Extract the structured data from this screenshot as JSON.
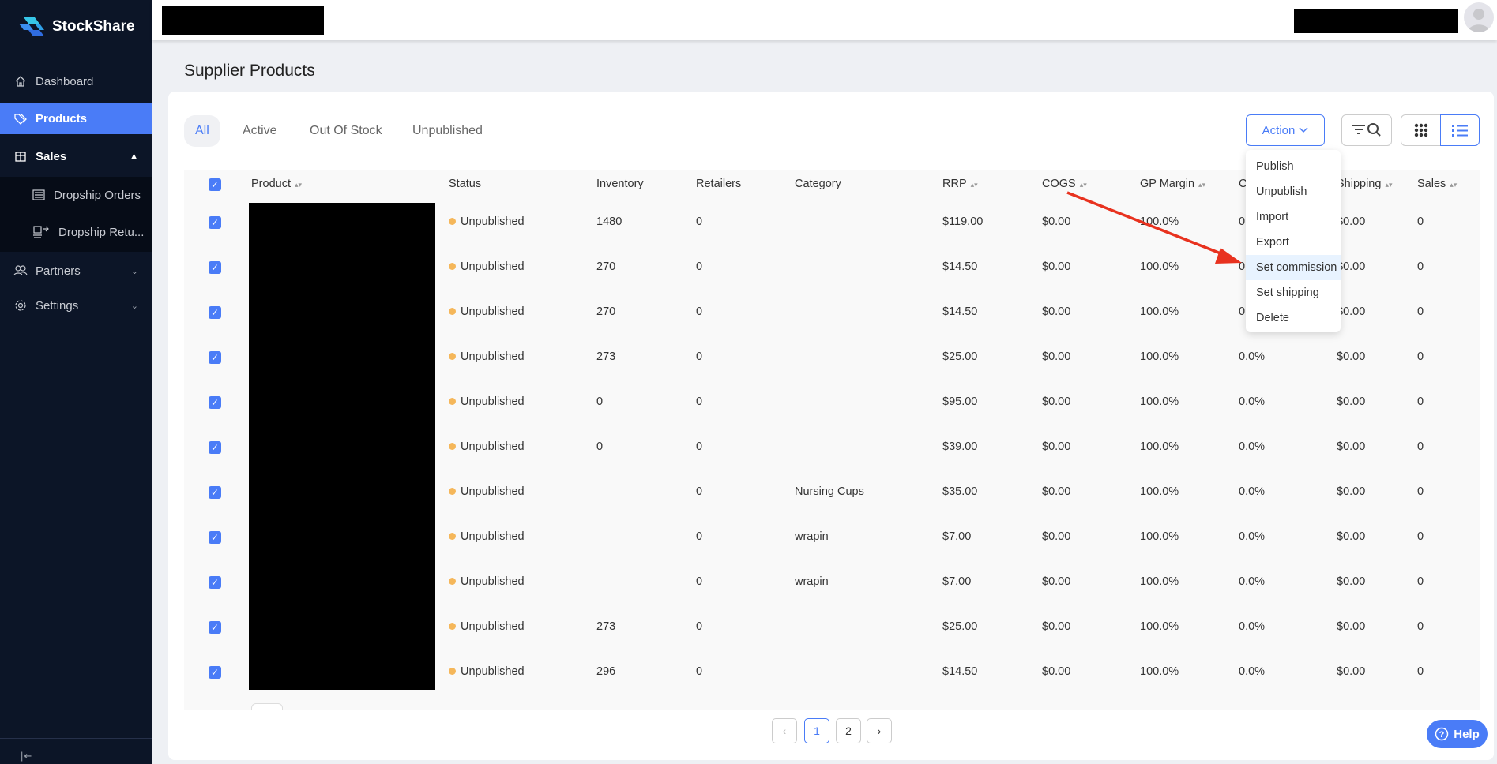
{
  "brand": {
    "name": "StockShare"
  },
  "sidebar": {
    "items": [
      {
        "label": "Dashboard",
        "icon": "home-icon"
      },
      {
        "label": "Products",
        "icon": "tag-icon"
      },
      {
        "label": "Sales",
        "icon": "box-icon"
      },
      {
        "label": "Dropship Orders",
        "icon": "list-icon"
      },
      {
        "label": "Dropship Retu...",
        "icon": "return-icon"
      },
      {
        "label": "Partners",
        "icon": "users-icon"
      },
      {
        "label": "Settings",
        "icon": "gear-icon"
      }
    ]
  },
  "page": {
    "title": "Supplier Products"
  },
  "tabs": [
    "All",
    "Active",
    "Out Of Stock",
    "Unpublished"
  ],
  "toolbar": {
    "action_label": "Action"
  },
  "action_menu": [
    "Publish",
    "Unpublish",
    "Import",
    "Export",
    "Set commission",
    "Set shipping",
    "Delete"
  ],
  "table": {
    "headers": [
      "Product",
      "Status",
      "Inventory",
      "Retailers",
      "Category",
      "RRP",
      "COGS",
      "GP Margin",
      "Commission",
      "Shipping",
      "Sales"
    ],
    "rows": [
      {
        "status": "Unpublished",
        "inventory": "1480",
        "retailers": "0",
        "category": "",
        "rrp": "$119.00",
        "cogs": "$0.00",
        "gp": "100.0%",
        "commission": "0.0%",
        "shipping": "$0.00",
        "sales": "0"
      },
      {
        "status": "Unpublished",
        "inventory": "270",
        "retailers": "0",
        "category": "",
        "rrp": "$14.50",
        "cogs": "$0.00",
        "gp": "100.0%",
        "commission": "0.0%",
        "shipping": "$0.00",
        "sales": "0"
      },
      {
        "status": "Unpublished",
        "inventory": "270",
        "retailers": "0",
        "category": "",
        "rrp": "$14.50",
        "cogs": "$0.00",
        "gp": "100.0%",
        "commission": "0.0%",
        "shipping": "$0.00",
        "sales": "0"
      },
      {
        "status": "Unpublished",
        "inventory": "273",
        "retailers": "0",
        "category": "",
        "rrp": "$25.00",
        "cogs": "$0.00",
        "gp": "100.0%",
        "commission": "0.0%",
        "shipping": "$0.00",
        "sales": "0"
      },
      {
        "status": "Unpublished",
        "inventory": "0",
        "retailers": "0",
        "category": "",
        "rrp": "$95.00",
        "cogs": "$0.00",
        "gp": "100.0%",
        "commission": "0.0%",
        "shipping": "$0.00",
        "sales": "0"
      },
      {
        "status": "Unpublished",
        "inventory": "0",
        "retailers": "0",
        "category": "",
        "rrp": "$39.00",
        "cogs": "$0.00",
        "gp": "100.0%",
        "commission": "0.0%",
        "shipping": "$0.00",
        "sales": "0"
      },
      {
        "status": "Unpublished",
        "inventory": "",
        "retailers": "0",
        "category": "Nursing Cups",
        "rrp": "$35.00",
        "cogs": "$0.00",
        "gp": "100.0%",
        "commission": "0.0%",
        "shipping": "$0.00",
        "sales": "0"
      },
      {
        "status": "Unpublished",
        "inventory": "",
        "retailers": "0",
        "category": "wrapin",
        "rrp": "$7.00",
        "cogs": "$0.00",
        "gp": "100.0%",
        "commission": "0.0%",
        "shipping": "$0.00",
        "sales": "0"
      },
      {
        "status": "Unpublished",
        "inventory": "",
        "retailers": "0",
        "category": "wrapin",
        "rrp": "$7.00",
        "cogs": "$0.00",
        "gp": "100.0%",
        "commission": "0.0%",
        "shipping": "$0.00",
        "sales": "0"
      },
      {
        "status": "Unpublished",
        "inventory": "273",
        "retailers": "0",
        "category": "",
        "rrp": "$25.00",
        "cogs": "$0.00",
        "gp": "100.0%",
        "commission": "0.0%",
        "shipping": "$0.00",
        "sales": "0"
      },
      {
        "status": "Unpublished",
        "inventory": "296",
        "retailers": "0",
        "category": "",
        "rrp": "$14.50",
        "cogs": "$0.00",
        "gp": "100.0%",
        "commission": "0.0%",
        "shipping": "$0.00",
        "sales": "0"
      }
    ]
  },
  "pagination": {
    "pages": [
      "1",
      "2"
    ],
    "current": "1"
  },
  "help": {
    "label": "Help"
  },
  "colors": {
    "accent": "#4a7cf7",
    "sidebar": "#0c1527",
    "status_unpublished": "#f5b75a",
    "annotation_arrow": "#e8321f"
  }
}
